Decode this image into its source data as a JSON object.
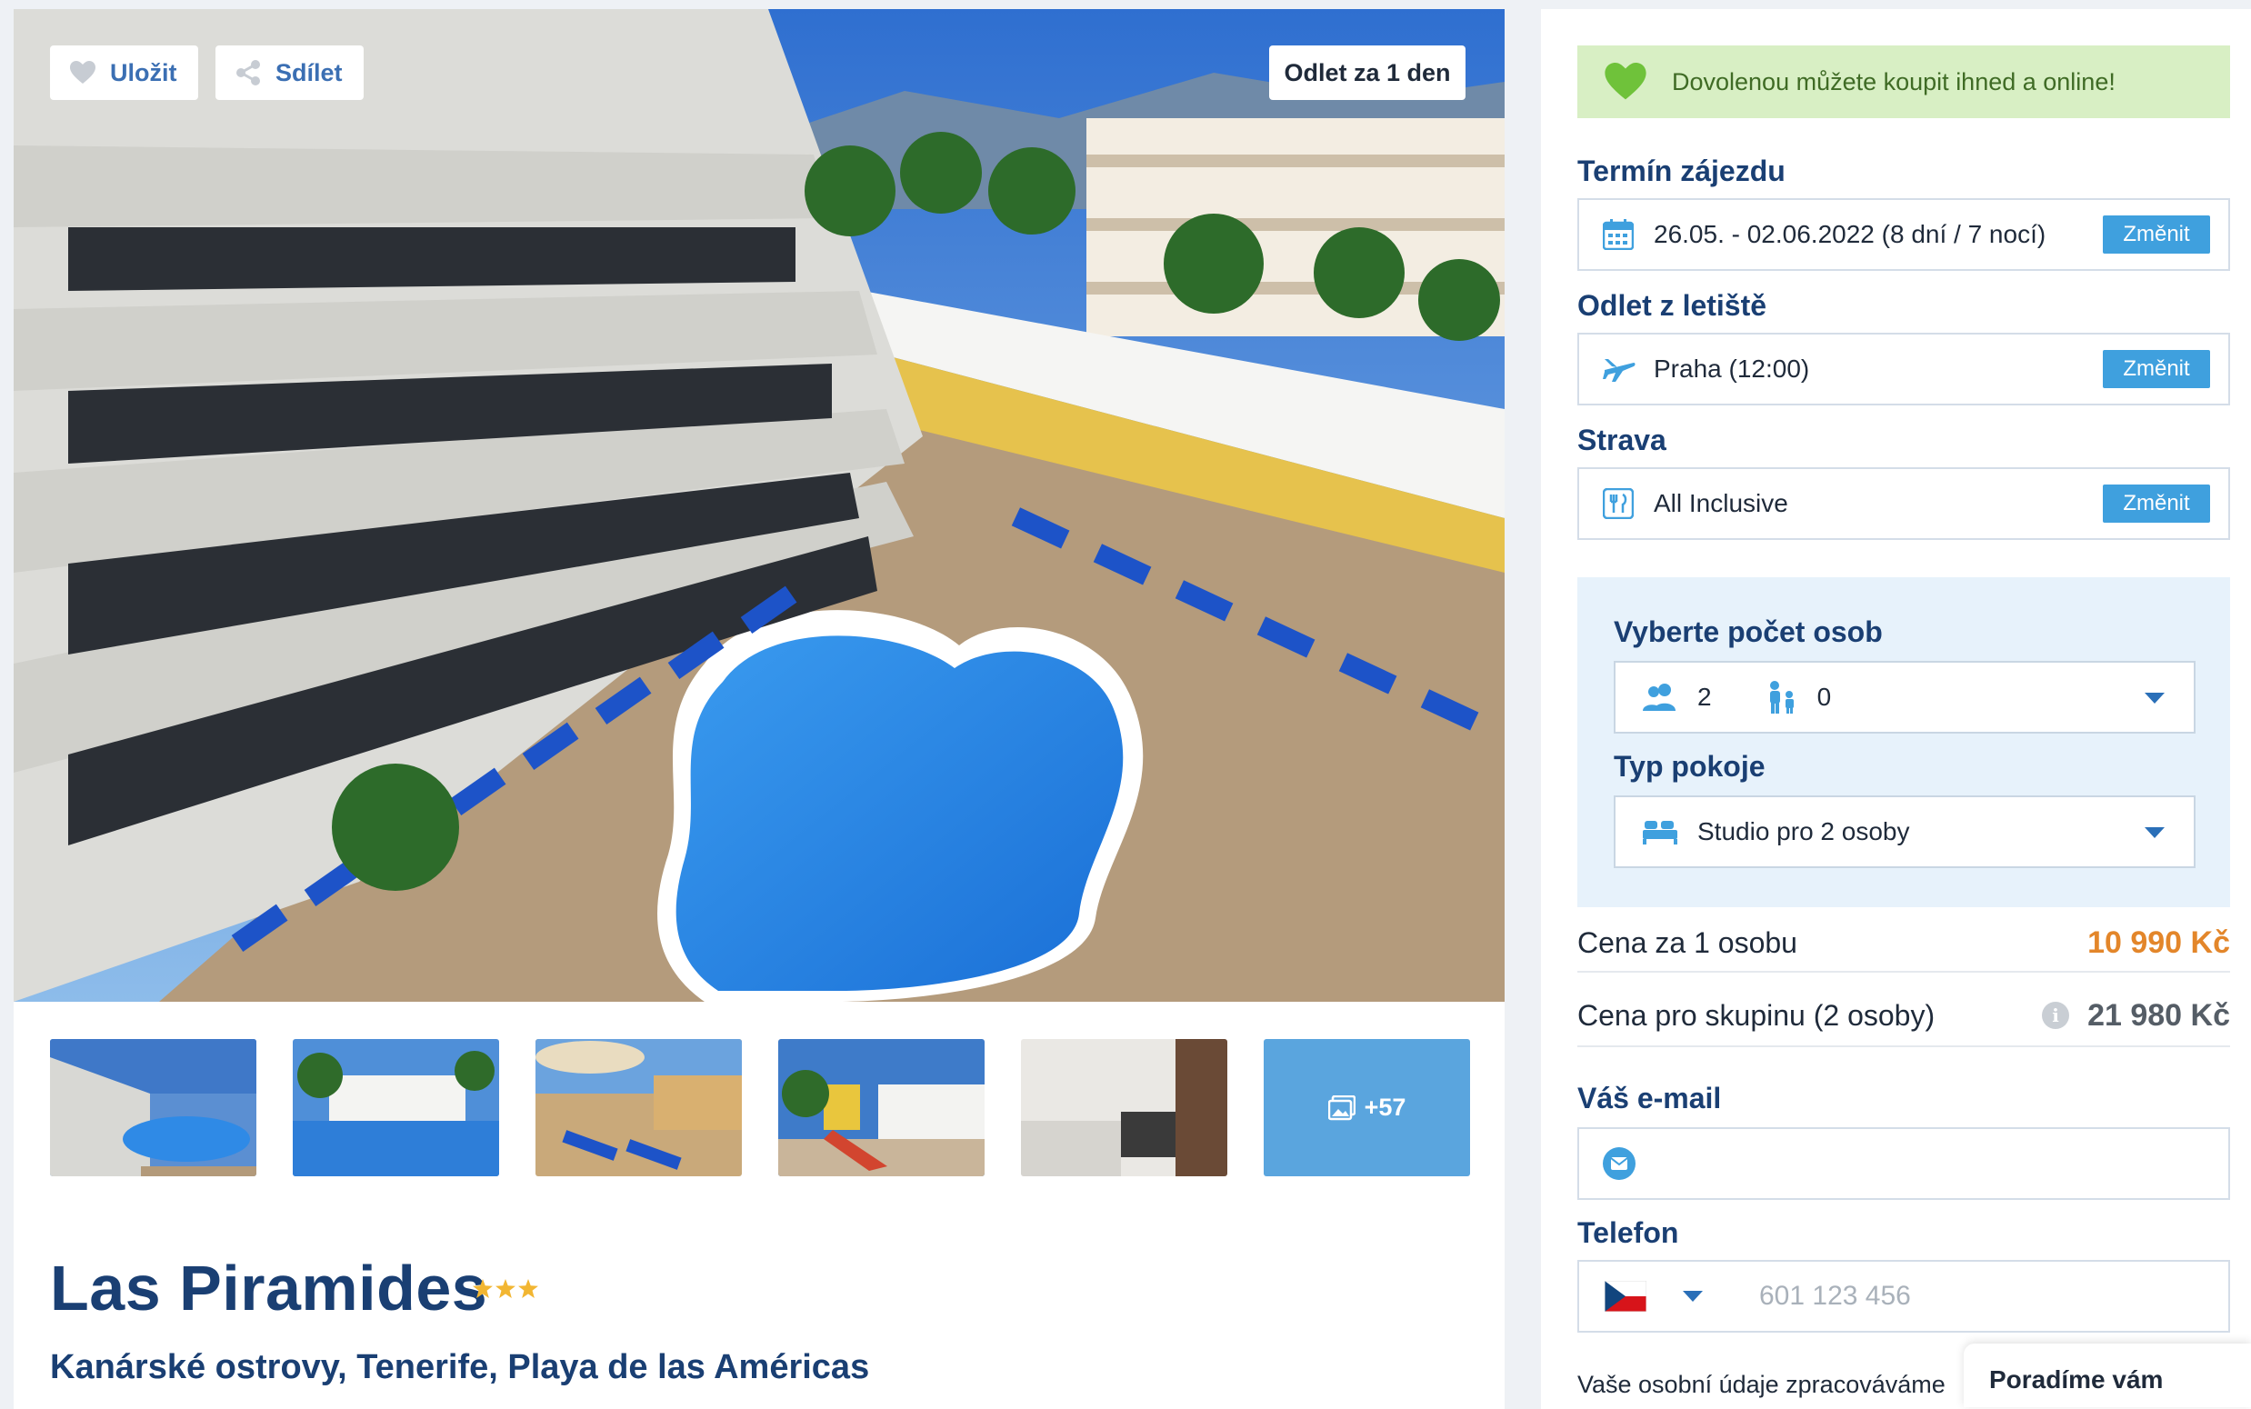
{
  "hero": {
    "save_label": "Uložit",
    "share_label": "Sdílet",
    "departure_badge": "Odlet za 1 den"
  },
  "gallery": {
    "more_label": "+57",
    "thumbnails": [
      "pool-overview",
      "pool-villas",
      "poolside-umbrella",
      "playground",
      "studio-room"
    ]
  },
  "hotel": {
    "name": "Las Piramides",
    "stars": 3,
    "location": "Kanárské ostrovy, Tenerife, Playa de las Américas"
  },
  "booking": {
    "banner_text": "Dovolenou můžete koupit ihned a online!",
    "term_label": "Termín zájezdu",
    "term_value": "26.05. - 02.06.2022 (8 dní / 7 nocí)",
    "airport_label": "Odlet z letiště",
    "airport_value": "Praha (12:00)",
    "meal_label": "Strava",
    "meal_value": "All Inclusive",
    "change_label": "Změnit",
    "persons_label": "Vyberte počet osob",
    "adults": "2",
    "children": "0",
    "room_label": "Typ pokoje",
    "room_value": "Studio pro 2 osoby",
    "price_per_person_label": "Cena za 1 osobu",
    "price_per_person": "10 990 Kč",
    "price_group_label": "Cena pro skupinu (2 osoby)",
    "price_group": "21 980 Kč",
    "email_label": "Váš e-mail",
    "phone_label": "Telefon",
    "phone_placeholder": "601 123 456",
    "privacy_text": "Vaše osobní údaje zpracováváme",
    "advise_text": "Poradíme vám"
  },
  "colors": {
    "brand_blue": "#1a3f73",
    "button_blue": "#3fa0de",
    "price_orange": "#e3862a",
    "banner_green": "#d8efc4",
    "star_gold": "#f2b632"
  },
  "icons": [
    "heart-icon",
    "share-icon",
    "calendar-icon",
    "plane-icon",
    "meal-icon",
    "adults-icon",
    "child-icon",
    "bed-icon",
    "email-icon",
    "czech-flag-icon",
    "gallery-icon",
    "info-icon"
  ]
}
